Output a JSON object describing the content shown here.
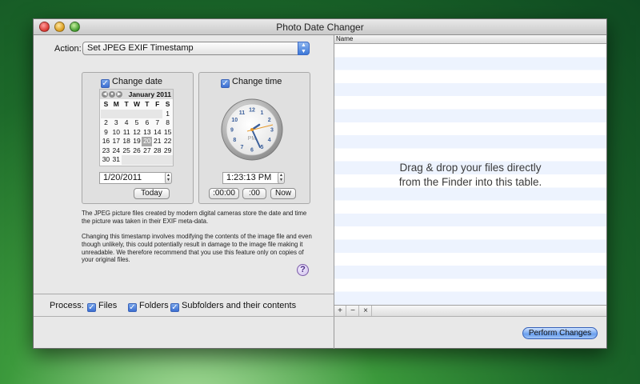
{
  "window": {
    "title": "Photo Date Changer"
  },
  "action": {
    "label": "Action:",
    "selected": "Set JPEG EXIF Timestamp"
  },
  "date_panel": {
    "checkbox_label": "Change date",
    "calendar": {
      "month": "January 2011",
      "weekdays": [
        "S",
        "M",
        "T",
        "W",
        "T",
        "F",
        "S"
      ],
      "weeks": [
        [
          "",
          "",
          "",
          "",
          "",
          "",
          "1"
        ],
        [
          "2",
          "3",
          "4",
          "5",
          "6",
          "7",
          "8"
        ],
        [
          "9",
          "10",
          "11",
          "12",
          "13",
          "14",
          "15"
        ],
        [
          "16",
          "17",
          "18",
          "19",
          "20",
          "21",
          "22"
        ],
        [
          "23",
          "24",
          "25",
          "26",
          "27",
          "28",
          "29"
        ],
        [
          "30",
          "31",
          "",
          "",
          "",
          "",
          ""
        ]
      ],
      "selected_day": "20"
    },
    "date_value": "1/20/2011",
    "today_button": "Today"
  },
  "time_panel": {
    "checkbox_label": "Change time",
    "clock_ampm": "PM",
    "clock_numbers": [
      "12",
      "1",
      "2",
      "3",
      "4",
      "5",
      "6",
      "7",
      "8",
      "9",
      "10",
      "11"
    ],
    "time_value": "1:23:13  PM",
    "btn_zero_seconds": ":00:00",
    "btn_zero_minutes": ":00",
    "now_button": "Now"
  },
  "info": {
    "paragraph1": "The JPEG picture files created by modern digital cameras store the date and time the picture was taken in their EXIF meta-data.",
    "paragraph2": "Changing this timestamp involves modifying the contents of the image file and even though unlikely, this could potentially result in damage to the image file making it unreadable. We therefore recommend that you use this feature only on copies of your original files."
  },
  "help_button": "?",
  "process": {
    "label": "Process:",
    "files": "Files",
    "folders": "Folders",
    "subfolders": "Subfolders and their contents"
  },
  "table": {
    "column_name": "Name",
    "drop_line1": "Drag & drop your files directly",
    "drop_line2": "from the Finder into this table.",
    "add": "+",
    "remove": "−",
    "clear": "×"
  },
  "perform_button": "Perform Changes",
  "colors": {
    "accent": "#3c78d8",
    "row_stripe": "#edf3fe"
  }
}
